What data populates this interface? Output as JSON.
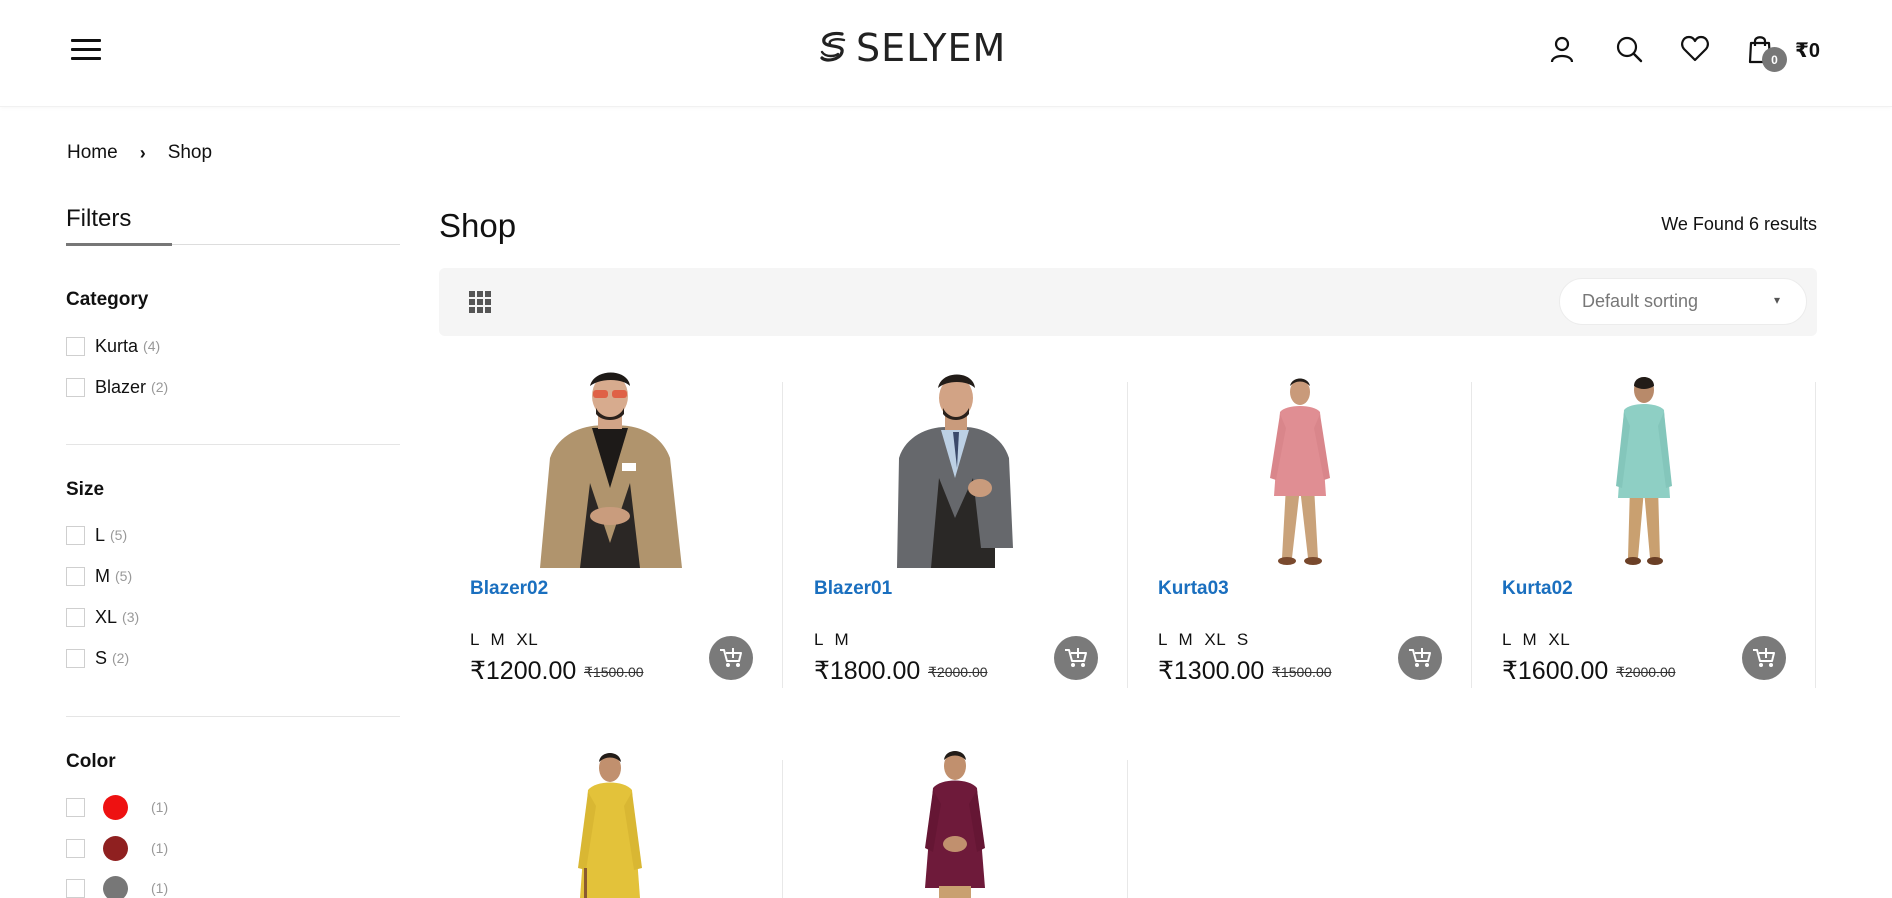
{
  "header": {
    "logo_text": "SELYEM",
    "cart_count": "0",
    "cart_total": "₹0",
    "icons": [
      "menu-icon",
      "user-icon",
      "search-icon",
      "heart-icon",
      "bag-icon"
    ]
  },
  "breadcrumb": {
    "home": "Home",
    "separator": "›",
    "current": "Shop"
  },
  "sidebar": {
    "title": "Filters",
    "category": {
      "heading": "Category",
      "items": [
        {
          "label": "Kurta",
          "count": "(4)"
        },
        {
          "label": "Blazer",
          "count": "(2)"
        }
      ]
    },
    "size": {
      "heading": "Size",
      "items": [
        {
          "label": "L",
          "count": "(5)"
        },
        {
          "label": "M",
          "count": "(5)"
        },
        {
          "label": "XL",
          "count": "(3)"
        },
        {
          "label": "S",
          "count": "(2)"
        }
      ]
    },
    "color": {
      "heading": "Color",
      "items": [
        {
          "color": "#ee1111",
          "count": "(1)"
        },
        {
          "color": "#8f2020",
          "count": "(1)"
        },
        {
          "color": "#777777",
          "count": "(1)"
        }
      ]
    }
  },
  "main": {
    "title": "Shop",
    "results": "We Found 6 results",
    "sort_label": "Default sorting",
    "products": [
      {
        "name": "Blazer02",
        "sizes": "L M XL",
        "price": "₹1200.00",
        "old_price": "₹1500.00",
        "image": "man in tan blazer"
      },
      {
        "name": "Blazer01",
        "sizes": "L M",
        "price": "₹1800.00",
        "old_price": "₹2000.00",
        "image": "man in grey blazer"
      },
      {
        "name": "Kurta03",
        "sizes": "L M XL S",
        "price": "₹1300.00",
        "old_price": "₹1500.00",
        "image": "man in pink kurta"
      },
      {
        "name": "Kurta02",
        "sizes": "L M XL",
        "price": "₹1600.00",
        "old_price": "₹2000.00",
        "image": "man in teal kurta"
      },
      {
        "name": "",
        "sizes": "",
        "price": "",
        "old_price": "",
        "image": "man in yellow kurta"
      },
      {
        "name": "",
        "sizes": "",
        "price": "",
        "old_price": "",
        "image": "man in maroon kurta"
      }
    ]
  },
  "colors": {
    "accent": "#1a6fbf",
    "text": "#111111",
    "muted": "#999999",
    "button": "#7a7a7a",
    "toolbar_bg": "#f5f5f5"
  }
}
